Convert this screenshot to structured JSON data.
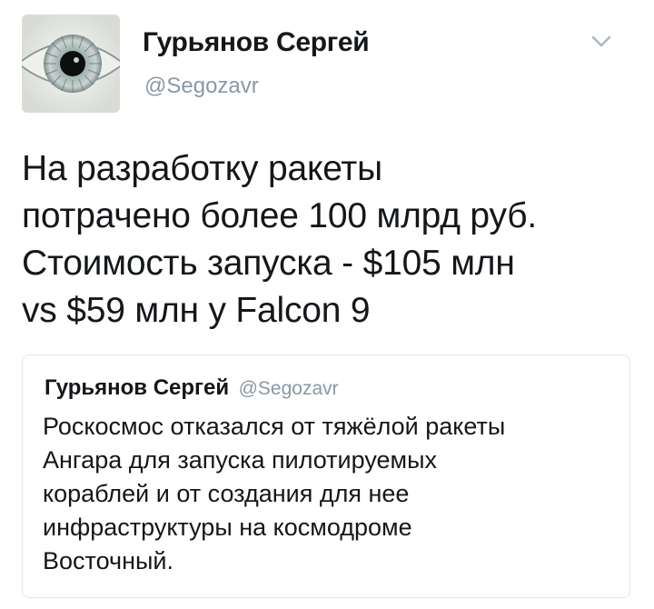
{
  "tweet": {
    "author_name": "Гурьянов Сергей",
    "author_handle": "@Segozavr",
    "text": "На разработку ракеты\nпотрачено более 100 млрд руб.\nСтоимость запуска - $105 млн\nvs $59 млн у Falcon 9",
    "menu_icon": "chevron-down-icon",
    "avatar_icon": "eye-avatar"
  },
  "quoted_tweet": {
    "author_name": "Гурьянов Сергей",
    "author_handle": "@Segozavr",
    "text": "Роскосмос отказался от тяжёлой ракеты\nАнгара для запуска пилотируемых\nкораблей и от создания для нее\nинфраструктуры на космодроме\nВосточный."
  },
  "colors": {
    "text": "#14171a",
    "secondary": "#8899a6",
    "border": "#e1e8ed"
  }
}
